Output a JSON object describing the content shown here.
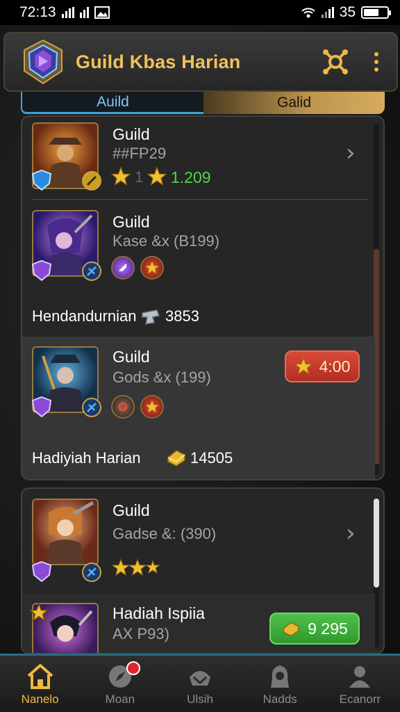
{
  "status_bar": {
    "time": "72:13",
    "battery": "35",
    "battery_level": 0.65
  },
  "header": {
    "title": "Guild Kbas Harian",
    "crest_icon": "shield-crest-icon",
    "settings_icon": "network-gear-icon",
    "more_icon": "kebab-menu-icon"
  },
  "tabs": [
    {
      "label": "Auild"
    },
    {
      "label": "Galid"
    }
  ],
  "guild_list": [
    {
      "name": "Guild",
      "tag": "##FP29",
      "rating_value": "1.209",
      "stars_label": "1"
    },
    {
      "name": "Guild",
      "tag": "Kase &x (B199)",
      "footer_label": "Hendandurnian",
      "footer_value": "3853"
    },
    {
      "name": "Guild",
      "tag": "Gods &x (199)",
      "timer": "4:00",
      "footer_label": "Hadiyiah Harian",
      "footer_value": "14505"
    },
    {
      "name": "Guild",
      "tag": "Gadse &: (390)"
    },
    {
      "name": "Hadiah Ispiia",
      "tag": "AX P93)",
      "reward_value": "9 295"
    }
  ],
  "bottom_nav": [
    {
      "label": "Nanelo",
      "icon": "home-icon",
      "active": true
    },
    {
      "label": "Moan",
      "icon": "compass-icon",
      "active": false
    },
    {
      "label": "Ulsih",
      "icon": "helmet-icon",
      "active": false
    },
    {
      "label": "Nadds",
      "icon": "hooded-figure-icon",
      "active": false
    },
    {
      "label": "Ecanorr",
      "icon": "profile-icon",
      "active": false
    }
  ],
  "colors": {
    "accent_gold": "#f1c15a",
    "tab_blue": "#7ec8f2",
    "rating_green": "#4cd84a",
    "timer_red": "#c83a2c",
    "reward_green": "#3fb03a"
  }
}
